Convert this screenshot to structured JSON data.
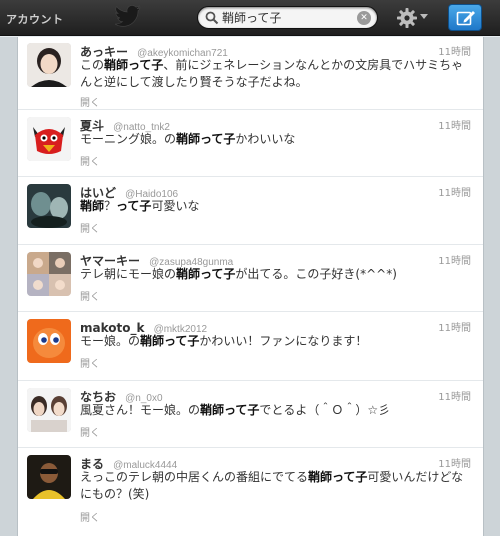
{
  "header": {
    "account_label": "アカウント",
    "search_value": "鞘師って子",
    "compose_label": "compose"
  },
  "tweets": [
    {
      "name": "あっキー",
      "handle": "@akeykomichan721",
      "time": "11時間",
      "segments": [
        {
          "t": "この"
        },
        {
          "t": "鞘師って子",
          "b": true
        },
        {
          "t": "、前にジェネレーションなんとかの文房具でハサミちゃんと逆にして渡したり賢そうな子だよね。"
        }
      ],
      "open": "開く"
    },
    {
      "name": "夏斗",
      "handle": "@natto_tnk2",
      "time": "11時間",
      "segments": [
        {
          "t": "モーニング娘。の"
        },
        {
          "t": "鞘師って子",
          "b": true
        },
        {
          "t": "かわいいな"
        }
      ],
      "open": "開く"
    },
    {
      "name": "はいど",
      "handle": "@Haido106",
      "time": "11時間",
      "segments": [
        {
          "t": "鞘師",
          "b": true
        },
        {
          "t": "？"
        },
        {
          "t": "って子",
          "b": true
        },
        {
          "t": "可愛いな"
        }
      ],
      "open": "開く"
    },
    {
      "name": "ヤマーキー",
      "handle": "@zasupa48gunma",
      "time": "11時間",
      "segments": [
        {
          "t": "テレ朝にモー娘の"
        },
        {
          "t": "鞘師って子",
          "b": true
        },
        {
          "t": "が出てる。この子好き(*^^*)"
        }
      ],
      "open": "開く"
    },
    {
      "name": "makoto_k",
      "handle": "@mktk2012",
      "time": "11時間",
      "segments": [
        {
          "t": "モー娘。の"
        },
        {
          "t": "鞘師って子",
          "b": true
        },
        {
          "t": "かわいい！ファンになります！"
        }
      ],
      "open": "開く"
    },
    {
      "name": "なちお",
      "handle": "@n_0x0",
      "time": "11時間",
      "segments": [
        {
          "t": "風夏さん！モー娘。の"
        },
        {
          "t": "鞘師って子",
          "b": true
        },
        {
          "t": "でとるよ（＾Ｏ＾）☆彡"
        }
      ],
      "open": "開く"
    },
    {
      "name": "まる",
      "handle": "@maluck4444",
      "time": "11時間",
      "segments": [
        {
          "t": "えっこのテレ朝の中居くんの番組にでてる"
        },
        {
          "t": "鞘師って子",
          "b": true
        },
        {
          "t": "可愛いんだけどなにもの？(笑)"
        }
      ],
      "open": "開く"
    }
  ]
}
